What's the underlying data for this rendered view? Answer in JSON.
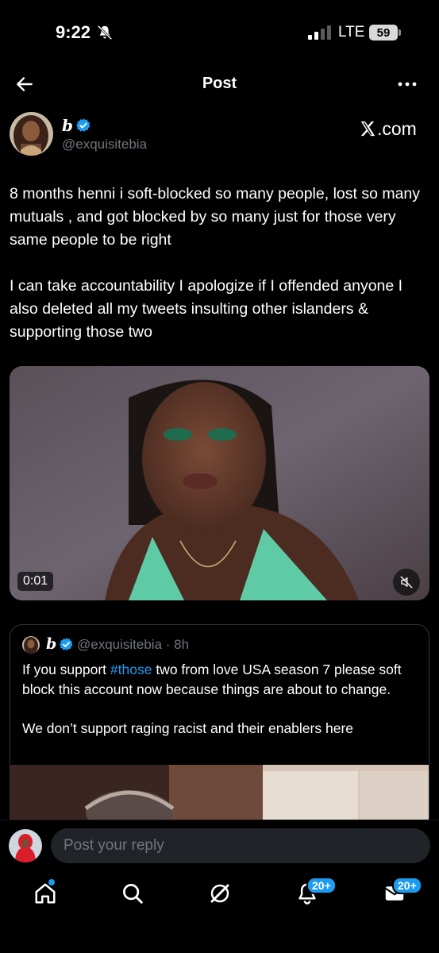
{
  "status_bar": {
    "time": "9:22",
    "network": "LTE",
    "battery": "59"
  },
  "header": {
    "title": "Post"
  },
  "post": {
    "author_name": "b",
    "author_handle": "@exquisitebia",
    "source_label": ".com",
    "paragraphs": [
      "8 months henni i soft-blocked so many people, lost so many mutuals , and got blocked by so many just for those very same people to be right",
      "I can take accountability I apologize if I offended anyone I also deleted all my tweets  insulting other islanders & supporting those two"
    ],
    "video": {
      "timestamp": "0:01"
    }
  },
  "quoted_post": {
    "author_name": "b",
    "meta": "@exquisitebia · 8h",
    "text_before_tag": "If you support ",
    "hashtag": "#those",
    "text_after_tag": " two from love USA season 7 please soft block this account now because things are about to change.",
    "second_paragraph": "We don’t support raging racist and their enablers here"
  },
  "reply": {
    "placeholder": "Post your reply"
  },
  "nav": {
    "notifications_badge": "20+",
    "messages_badge": "20+"
  },
  "colors": {
    "accent": "#1d9bf0",
    "background": "#000000",
    "muted": "#71767b"
  }
}
